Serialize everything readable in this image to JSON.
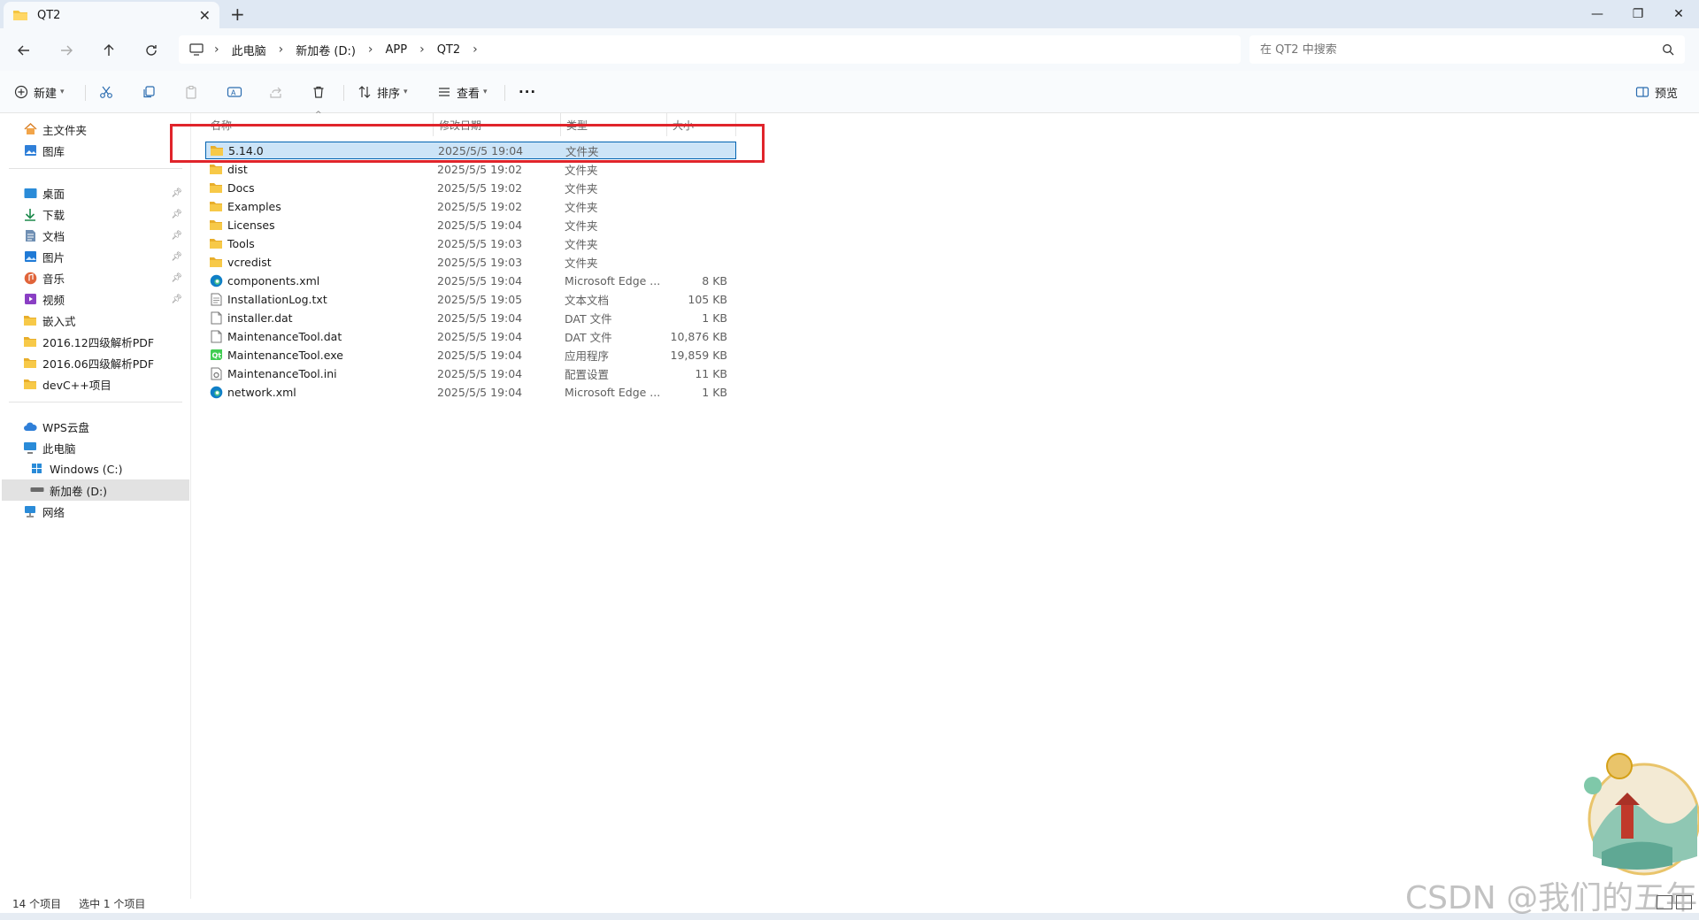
{
  "window": {
    "tab_title": "QT2",
    "new_tab": "+",
    "minimize": "—",
    "restore": "❐",
    "close": "✕"
  },
  "breadcrumb": [
    "此电脑",
    "新加卷 (D:)",
    "APP",
    "QT2"
  ],
  "search": {
    "placeholder": "在 QT2 中搜索"
  },
  "toolbar": {
    "new_label": "新建",
    "sort_label": "排序",
    "view_label": "查看",
    "more_label": "···",
    "preview_label": "预览"
  },
  "sidebar": {
    "top": [
      {
        "label": "主文件夹",
        "icon": "home-icon"
      },
      {
        "label": "图库",
        "icon": "gallery-icon"
      }
    ],
    "pinned": [
      {
        "label": "桌面",
        "icon": "desktop-icon",
        "pinned": true
      },
      {
        "label": "下载",
        "icon": "download-icon",
        "pinned": true
      },
      {
        "label": "文档",
        "icon": "document-icon",
        "pinned": true
      },
      {
        "label": "图片",
        "icon": "pictures-icon",
        "pinned": true
      },
      {
        "label": "音乐",
        "icon": "music-icon",
        "pinned": true
      },
      {
        "label": "视频",
        "icon": "video-icon",
        "pinned": true
      },
      {
        "label": "嵌入式",
        "icon": "folder-icon",
        "pinned": false
      },
      {
        "label": "2016.12四级解析PDF",
        "icon": "folder-icon",
        "pinned": false
      },
      {
        "label": "2016.06四级解析PDF",
        "icon": "folder-icon",
        "pinned": false
      },
      {
        "label": "devC++项目",
        "icon": "folder-icon",
        "pinned": false
      }
    ],
    "locations": [
      {
        "label": "WPS云盘",
        "icon": "cloud-icon"
      },
      {
        "label": "此电脑",
        "icon": "computer-icon"
      },
      {
        "label": "Windows (C:)",
        "icon": "windows-drive-icon"
      },
      {
        "label": "新加卷 (D:)",
        "icon": "drive-icon",
        "selected": true
      },
      {
        "label": "网络",
        "icon": "network-icon"
      }
    ]
  },
  "columns": {
    "name": "名称",
    "date": "修改日期",
    "type": "类型",
    "size": "大小"
  },
  "files": [
    {
      "name": "5.14.0",
      "date": "2025/5/5 19:04",
      "type": "文件夹",
      "size": "",
      "icon": "folder-icon",
      "selected": true
    },
    {
      "name": "dist",
      "date": "2025/5/5 19:02",
      "type": "文件夹",
      "size": "",
      "icon": "folder-icon"
    },
    {
      "name": "Docs",
      "date": "2025/5/5 19:02",
      "type": "文件夹",
      "size": "",
      "icon": "folder-icon"
    },
    {
      "name": "Examples",
      "date": "2025/5/5 19:02",
      "type": "文件夹",
      "size": "",
      "icon": "folder-icon"
    },
    {
      "name": "Licenses",
      "date": "2025/5/5 19:04",
      "type": "文件夹",
      "size": "",
      "icon": "folder-icon"
    },
    {
      "name": "Tools",
      "date": "2025/5/5 19:03",
      "type": "文件夹",
      "size": "",
      "icon": "folder-icon"
    },
    {
      "name": "vcredist",
      "date": "2025/5/5 19:03",
      "type": "文件夹",
      "size": "",
      "icon": "folder-icon"
    },
    {
      "name": "components.xml",
      "date": "2025/5/5 19:04",
      "type": "Microsoft Edge ...",
      "size": "8 KB",
      "icon": "edge-icon"
    },
    {
      "name": "InstallationLog.txt",
      "date": "2025/5/5 19:05",
      "type": "文本文档",
      "size": "105 KB",
      "icon": "text-file-icon"
    },
    {
      "name": "installer.dat",
      "date": "2025/5/5 19:04",
      "type": "DAT 文件",
      "size": "1 KB",
      "icon": "file-icon"
    },
    {
      "name": "MaintenanceTool.dat",
      "date": "2025/5/5 19:04",
      "type": "DAT 文件",
      "size": "10,876 KB",
      "icon": "file-icon"
    },
    {
      "name": "MaintenanceTool.exe",
      "date": "2025/5/5 19:04",
      "type": "应用程序",
      "size": "19,859 KB",
      "icon": "qt-icon"
    },
    {
      "name": "MaintenanceTool.ini",
      "date": "2025/5/5 19:04",
      "type": "配置设置",
      "size": "11 KB",
      "icon": "settings-file-icon"
    },
    {
      "name": "network.xml",
      "date": "2025/5/5 19:04",
      "type": "Microsoft Edge ...",
      "size": "1 KB",
      "icon": "edge-icon"
    }
  ],
  "status": {
    "count": "14 个项目",
    "selected": "选中 1 个项目"
  },
  "watermark": "CSDN @我们的五年",
  "colors": {
    "selection": "#cce4f7",
    "selection_border": "#0063b1",
    "annotation": "#e0242b",
    "folder": "#f4c542"
  }
}
